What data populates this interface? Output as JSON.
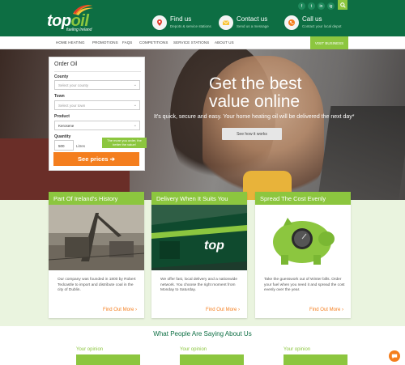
{
  "brand": {
    "logo_main": "top",
    "logo_accent": "oil",
    "tagline": "fueling Ireland",
    "colors": {
      "dark_green": "#0d6e43",
      "lime": "#8cc63f",
      "orange": "#f47e1e"
    }
  },
  "header": {
    "items": [
      {
        "title": "Find us",
        "sub": "Depots & service stations",
        "icon": "map-pin-icon"
      },
      {
        "title": "Contact us",
        "sub": "Send us a message",
        "icon": "envelope-icon"
      },
      {
        "title": "Call us",
        "sub": "Contact your local depot",
        "icon": "phone-icon"
      }
    ],
    "social": [
      {
        "label": "f",
        "icon": "facebook-icon"
      },
      {
        "label": "t",
        "icon": "twitter-icon"
      },
      {
        "label": "in",
        "icon": "linkedin-icon"
      },
      {
        "label": "ig",
        "icon": "instagram-icon"
      }
    ],
    "search_icon": "search-icon"
  },
  "nav": {
    "items": [
      "HOME HEATING",
      "PROMOTIONS",
      "FAQS",
      "COMPETITIONS",
      "SERVICE STATIONS",
      "ABOUT US"
    ],
    "cta": "VISIT BUSINESS"
  },
  "hero": {
    "headline_line1": "Get the best",
    "headline_line2": "value online",
    "subtext": "It's quick, secure and easy. Your home heating oil will be delivered the next day*",
    "button": "See how it works"
  },
  "order": {
    "title": "Order Oil",
    "county_label": "County",
    "county_placeholder": "Select your county",
    "town_label": "Town",
    "town_placeholder": "Select your town",
    "product_label": "Product",
    "product_value": "Kerosene",
    "quantity_label": "Quantity",
    "quantity_value": "500",
    "quantity_unit": "Litres",
    "quantity_tip": "The more you order, the better the value!",
    "submit": "See prices"
  },
  "cards": [
    {
      "title": "Part Of Ireland's History",
      "text": "Our company was founded in 1800 by Robert Tedcastle to import and distribute coal in the city of Dublin.",
      "link": "Find Out More"
    },
    {
      "title": "Delivery When It Suits You",
      "text": "We offer fast, local delivery and a nationwide network. You choose the right moment from Monday to Saturday.",
      "link": "Find Out More"
    },
    {
      "title": "Spread The Cost Evenly",
      "text": "Take the guesswork out of Winter bills. Order your fuel when you need it and spread the cost evenly over the year.",
      "link": "Find Out More"
    }
  ],
  "testimonials": {
    "title": "What People Are Saying About Us",
    "opinions": [
      "Your opinion",
      "Your opinion",
      "Your opinion"
    ]
  }
}
